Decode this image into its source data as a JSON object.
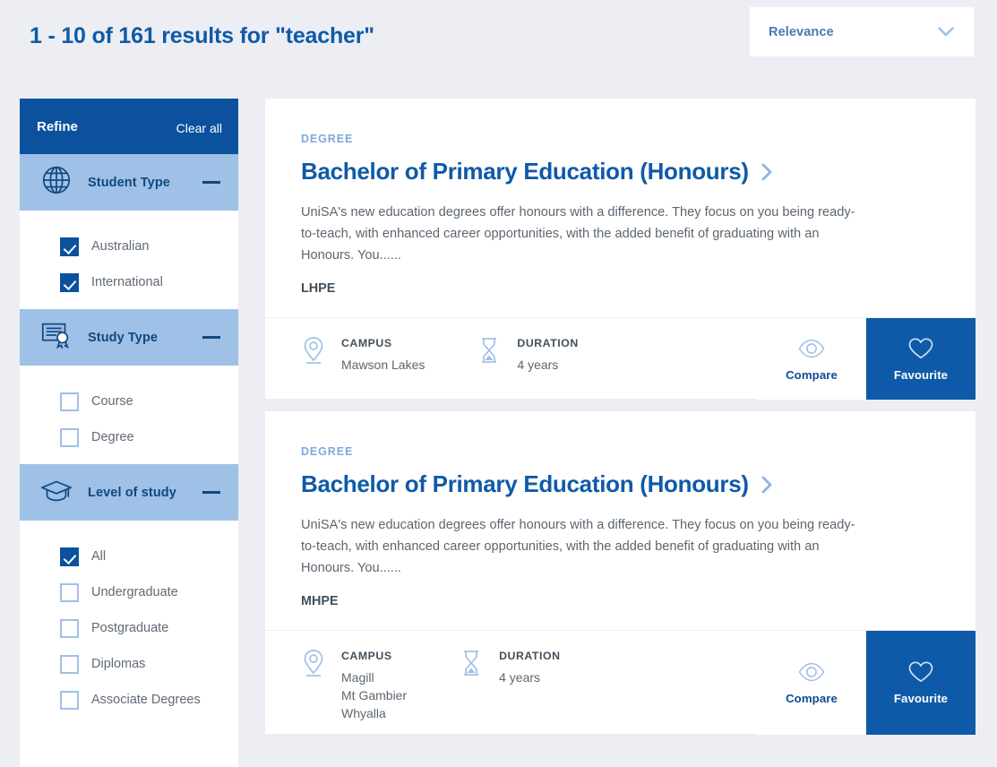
{
  "header": {
    "results_heading": "1 - 10 of 161 results for \"teacher\"",
    "sort": {
      "selected": "Relevance",
      "icon": "chevron-down-icon"
    }
  },
  "sidebar": {
    "title": "Refine",
    "clear_all": "Clear all",
    "facets": [
      {
        "title": "Student Type",
        "icon": "globe-icon",
        "collapse_icon": "minus-icon",
        "options": [
          {
            "label": "Australian",
            "checked": true
          },
          {
            "label": "International",
            "checked": true
          }
        ]
      },
      {
        "title": "Study Type",
        "icon": "certificate-icon",
        "collapse_icon": "minus-icon",
        "options": [
          {
            "label": "Course",
            "checked": false
          },
          {
            "label": "Degree",
            "checked": false
          }
        ]
      },
      {
        "title": "Level of study",
        "icon": "graduation-cap-icon",
        "collapse_icon": "minus-icon",
        "options": [
          {
            "label": "All",
            "checked": true
          },
          {
            "label": "Undergraduate",
            "checked": false
          },
          {
            "label": "Postgraduate",
            "checked": false
          },
          {
            "label": "Diplomas",
            "checked": false
          },
          {
            "label": "Associate Degrees",
            "checked": false
          }
        ]
      }
    ]
  },
  "results": [
    {
      "kicker": "DEGREE",
      "title": "Bachelor of Primary Education (Honours)",
      "link_icon": "chevron-right-icon",
      "description": "UniSA's new education degrees offer honours with a difference. They focus on you being ready-to-teach, with enhanced career opportunities, with the added benefit of graduating with an Honours. You......",
      "code": "LHPE",
      "campus_label": "CAMPUS",
      "campus_icon": "map-pin-icon",
      "campus_value": "Mawson Lakes",
      "duration_label": "DURATION",
      "duration_icon": "hourglass-icon",
      "duration_value": "4 years",
      "compare_label": "Compare",
      "compare_icon": "eye-icon",
      "favourite_label": "Favourite",
      "favourite_icon": "heart-icon"
    },
    {
      "kicker": "DEGREE",
      "title": "Bachelor of Primary Education (Honours)",
      "link_icon": "chevron-right-icon",
      "description": "UniSA's new education degrees offer honours with a difference. They focus on you being ready-to-teach, with enhanced career opportunities, with the added benefit of graduating with an Honours. You......",
      "code": "MHPE",
      "campus_label": "CAMPUS",
      "campus_icon": "map-pin-icon",
      "campus_value": "Magill\nMt Gambier\nWhyalla",
      "duration_label": "DURATION",
      "duration_icon": "hourglass-icon",
      "duration_value": "4 years",
      "compare_label": "Compare",
      "compare_icon": "eye-icon",
      "favourite_label": "Favourite",
      "favourite_icon": "heart-icon"
    }
  ],
  "colors": {
    "brand_dark_blue": "#0b519e",
    "brand_blue": "#0f5aa8",
    "light_blue": "#9fc0e7",
    "page_background": "#eceef3",
    "body_text": "#5c6670"
  }
}
